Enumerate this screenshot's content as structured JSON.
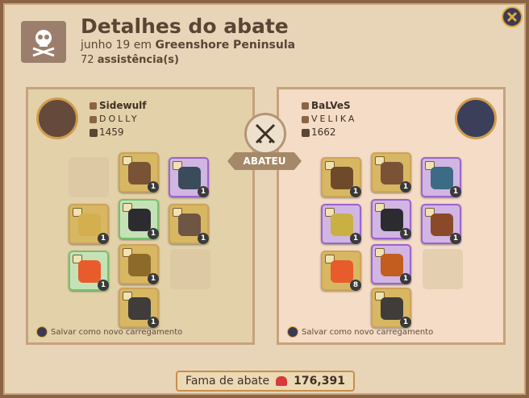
{
  "header": {
    "title": "Detalhes do abate",
    "date": "junho 19",
    "location_prefix": "em",
    "location": "Greenshore Peninsula",
    "assist_count": "72",
    "assist_label": "assistência(s)"
  },
  "killer": {
    "name": "Sidewulf",
    "guild": "DOLLY",
    "ip": "1459"
  },
  "victim": {
    "name": "BaLVeS",
    "guild": "VELIKA",
    "ip": "1662"
  },
  "center": {
    "banner": "ABATEU"
  },
  "save_label": "Salvar como novo carregamento",
  "fame": {
    "label": "Fama de abate",
    "value": "176,391"
  },
  "colors": {
    "background": "#e8d5b8",
    "left_panel": "#e3d1a9",
    "right_panel": "#f4dcc6",
    "accent_gold": "#cfa35a",
    "rare_purple": "#9d63d0",
    "uncommon_green": "#74c26c"
  },
  "killer_slots": [
    {
      "name": "head",
      "badge": "1",
      "style": "gold",
      "color": "#7a5236"
    },
    {
      "name": "cape",
      "badge": "1",
      "style": "purple",
      "color": "#3a4c5a"
    },
    {
      "name": "mainhand",
      "badge": "1",
      "style": "gold",
      "color": "#d3b04d"
    },
    {
      "name": "armor",
      "badge": "1",
      "style": "green",
      "color": "#2c2c30"
    },
    {
      "name": "offhand",
      "badge": "1",
      "style": "gold",
      "color": "#6e5544"
    },
    {
      "name": "potion",
      "badge": "1",
      "style": "green",
      "color": "#e85c2c"
    },
    {
      "name": "shoes",
      "badge": "1",
      "style": "gold",
      "color": "#8e6a2a"
    },
    {
      "name": "mount",
      "badge": "1",
      "style": "gold",
      "color": "#3f3c3a"
    }
  ],
  "victim_slots": [
    {
      "name": "bag",
      "badge": "1",
      "style": "gold",
      "color": "#6f4a2a"
    },
    {
      "name": "head",
      "badge": "1",
      "style": "gold",
      "color": "#7a5236"
    },
    {
      "name": "cape",
      "badge": "1",
      "style": "purple",
      "color": "#3c6b85"
    },
    {
      "name": "mainhand",
      "badge": "1",
      "style": "purple",
      "color": "#c9b043"
    },
    {
      "name": "armor",
      "badge": "1",
      "style": "purple",
      "color": "#2c2c30"
    },
    {
      "name": "offhand",
      "badge": "1",
      "style": "purple",
      "color": "#8a4a2a"
    },
    {
      "name": "potion",
      "badge": "8",
      "style": "gold",
      "color": "#e85c2c"
    },
    {
      "name": "shoes",
      "badge": "1",
      "style": "purple",
      "color": "#c25c1f"
    },
    {
      "name": "mount",
      "badge": "1",
      "style": "gold",
      "color": "#3f3c3a"
    }
  ]
}
